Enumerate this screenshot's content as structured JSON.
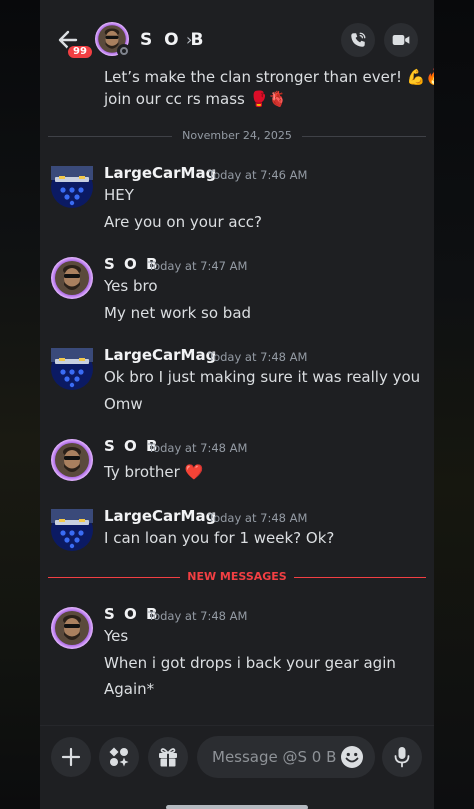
{
  "header": {
    "unread_badge": "99",
    "title": "S O B",
    "chevron": "›"
  },
  "previous_message": {
    "line1": "Let’s make the clan stronger than ever! 💪🔥",
    "line2": "join our cc rs mass 🥊🫀"
  },
  "date_divider": "November 24, 2025",
  "new_messages_divider": "NEW MESSAGES",
  "messages": [
    {
      "author": "LargeCarMag",
      "time": "Today at 7:46 AM",
      "lines": [
        "HEY",
        "Are you on your acc?"
      ]
    },
    {
      "author": "S O B",
      "time": "Today at 7:47 AM",
      "lines": [
        "Yes bro",
        "My net work so bad"
      ]
    },
    {
      "author": "LargeCarMag",
      "time": "Today at 7:48 AM",
      "lines": [
        "Ok bro I just making sure it was really you",
        "Omw"
      ]
    },
    {
      "author": "S O B",
      "time": "Today at 7:48 AM",
      "lines": [
        "Ty brother ❤️"
      ]
    },
    {
      "author": "LargeCarMag",
      "time": "Today at 7:48 AM",
      "lines": [
        "I can loan you for 1 week? Ok?"
      ]
    },
    {
      "author": "S O B",
      "time": "Today at 7:48 AM",
      "lines": [
        "Yes",
        "When i got drops i back your gear agin",
        "Again*"
      ]
    }
  ],
  "composer": {
    "placeholder": "Message @S 0 B"
  },
  "icons": {
    "back": "arrow-left-icon",
    "call": "phone-icon",
    "video": "video-camera-icon",
    "add": "plus-icon",
    "apps": "apps-icon",
    "gift": "gift-icon",
    "emoji": "smiley-icon",
    "mic": "microphone-icon"
  },
  "colors": {
    "background": "#1e1f22",
    "new_messages": "#f23f43",
    "badge": "#f23f43",
    "sob_ring": "#b86bff"
  }
}
